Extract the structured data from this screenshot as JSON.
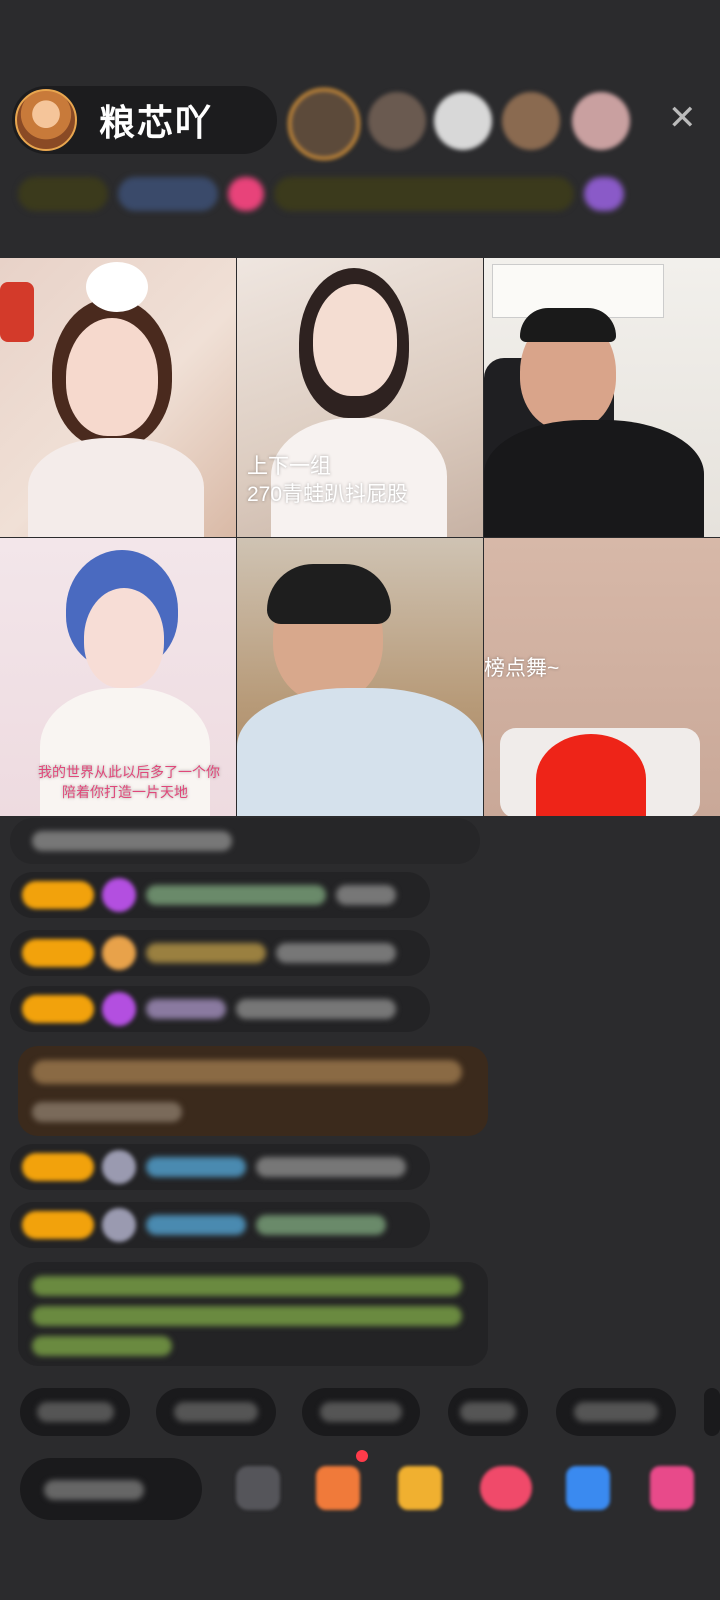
{
  "header": {
    "host_name": "粮芯吖",
    "close_icon": "close-icon"
  },
  "video_grid": {
    "tiles": [
      {
        "name": "streamer-1",
        "caption": ""
      },
      {
        "name": "streamer-2",
        "caption_line1": "上下一组",
        "caption_line2": "270青蛙趴抖屁股"
      },
      {
        "name": "streamer-3",
        "caption": ""
      },
      {
        "name": "streamer-4",
        "caption_line1": "我的世界从此以后多了一个你",
        "caption_line2": "陪着你打造一片天地"
      },
      {
        "name": "streamer-5",
        "caption": ""
      },
      {
        "name": "streamer-6",
        "caption": "榜点舞~"
      }
    ]
  },
  "colors": {
    "background": "#2b2b2d",
    "badge": "#f2a20c",
    "pill": "#1a1a1c"
  }
}
